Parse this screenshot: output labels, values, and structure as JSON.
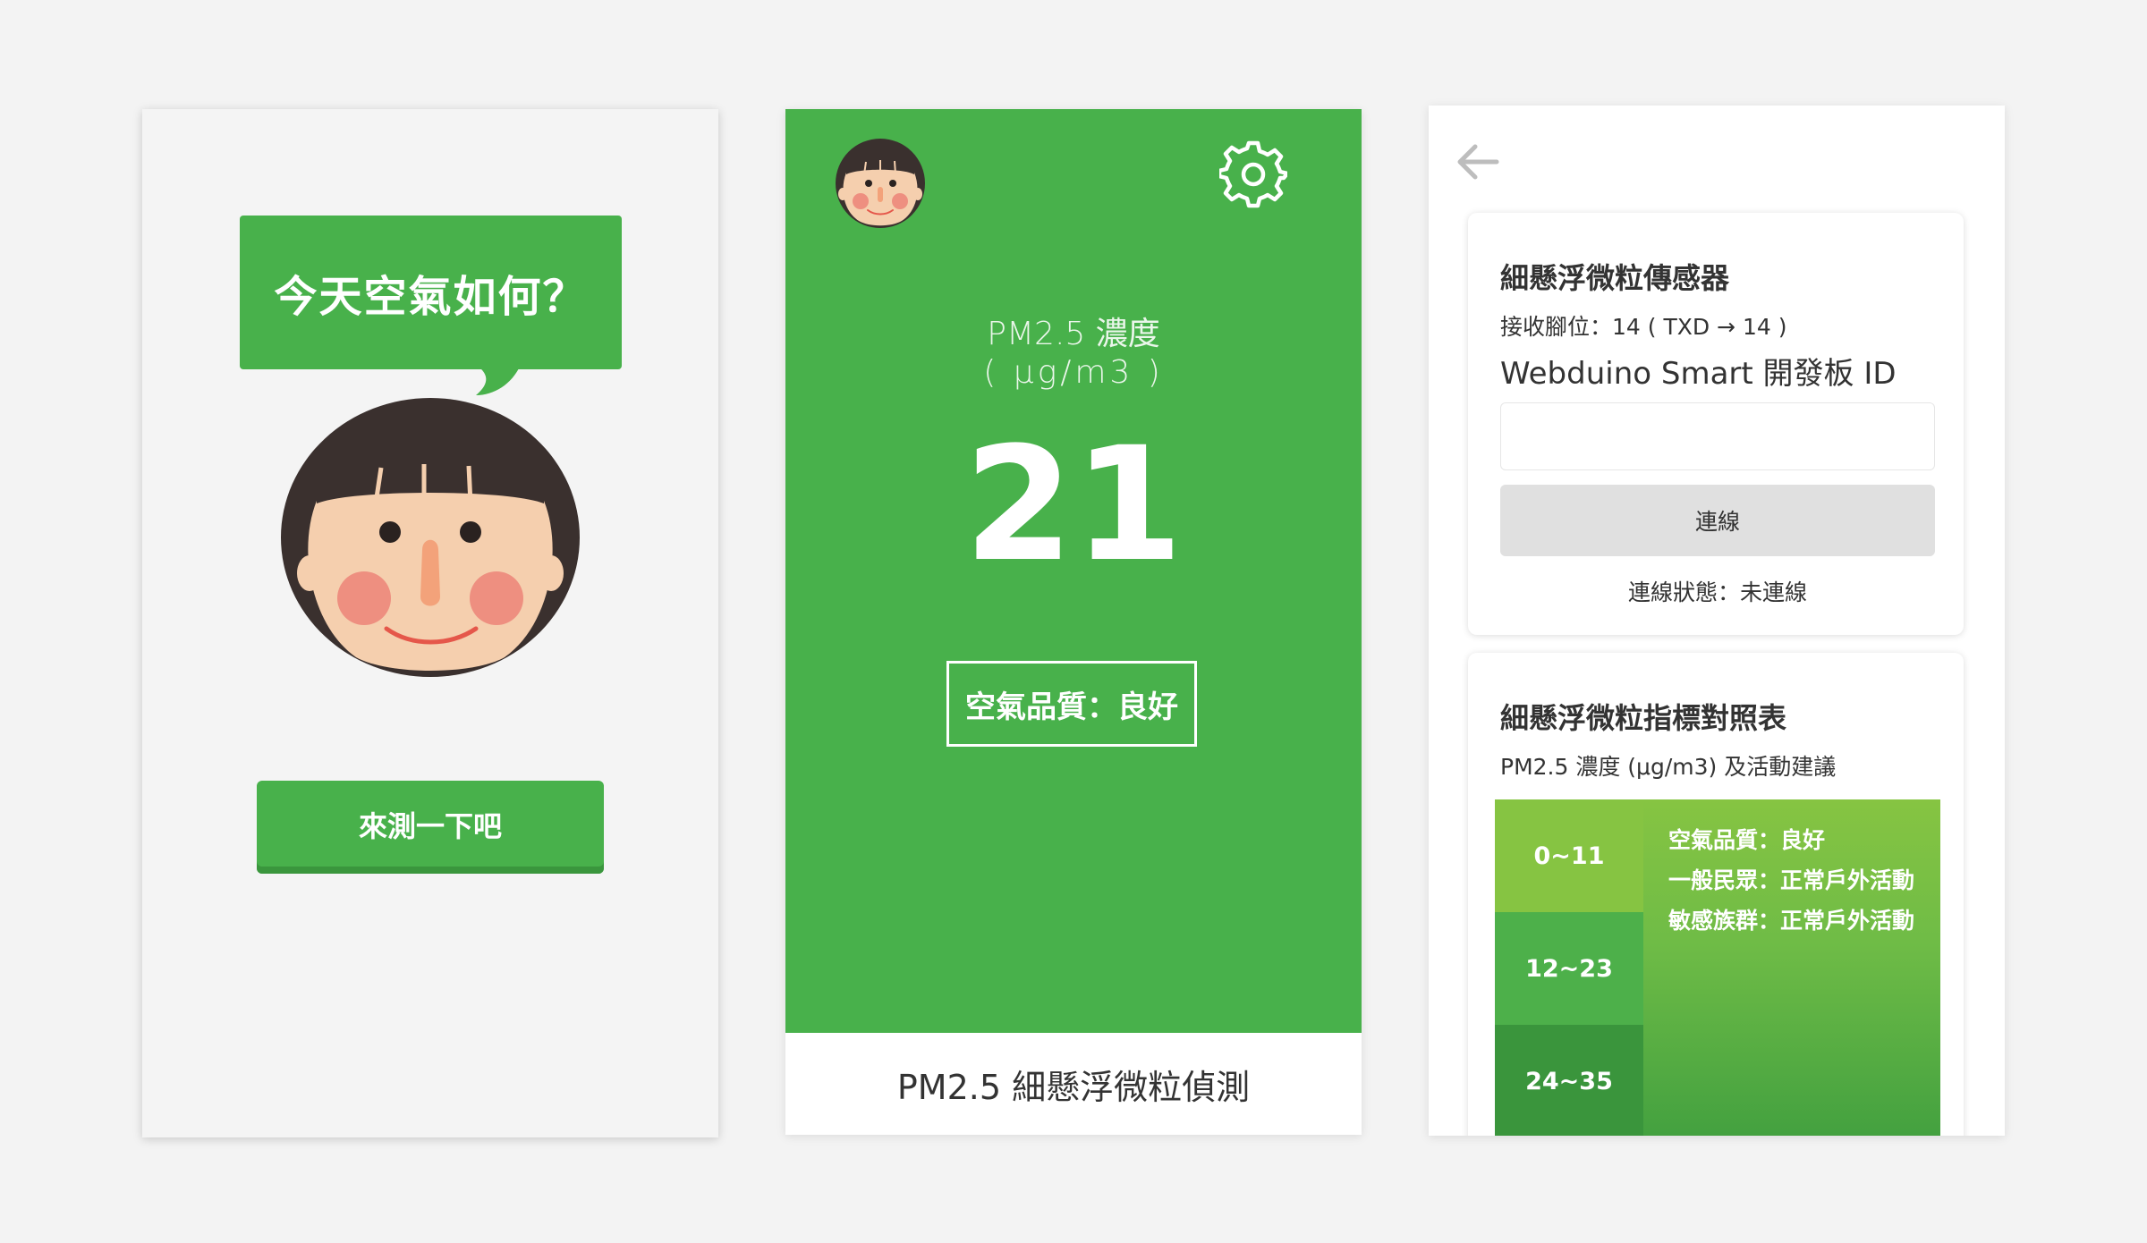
{
  "welcome": {
    "question": "今天空氣如何？",
    "start_button": "來測一下吧"
  },
  "monitor": {
    "pm_label": "PM2.5 濃度",
    "unit": "( μg/m3 )",
    "value": "21",
    "quality": "空氣品質：良好",
    "footer": "PM2.5 細懸浮微粒偵測"
  },
  "settings": {
    "sensor_card": {
      "title": "細懸浮微粒傳感器",
      "pin_info": "接收腳位：14 ( TXD → 14 )",
      "board_label": "Webduino Smart 開發板 ID",
      "id_value": "",
      "connect_button": "連線",
      "status": "連線狀態：未連線"
    },
    "table_card": {
      "title": "細懸浮微粒指標對照表",
      "subtitle": "PM2.5 濃度 (μg/m3) 及活動建議",
      "ranges": [
        {
          "range": "0~11",
          "color": "#86c442"
        },
        {
          "range": "12~23",
          "color": "#4db04a"
        },
        {
          "range": "24~35",
          "color": "#3a953c"
        }
      ],
      "advice": [
        "空氣品質：良好",
        "一般民眾：正常戶外活動",
        "敏感族群：正常戶外活動"
      ]
    }
  },
  "icons": {
    "gear": "gear-icon",
    "back": "back-arrow-icon",
    "avatar": "girl-face-icon"
  },
  "colors": {
    "primary_green": "#48b14b",
    "button_shadow": "#3a963d",
    "connect_bg": "#e0e0e0"
  }
}
